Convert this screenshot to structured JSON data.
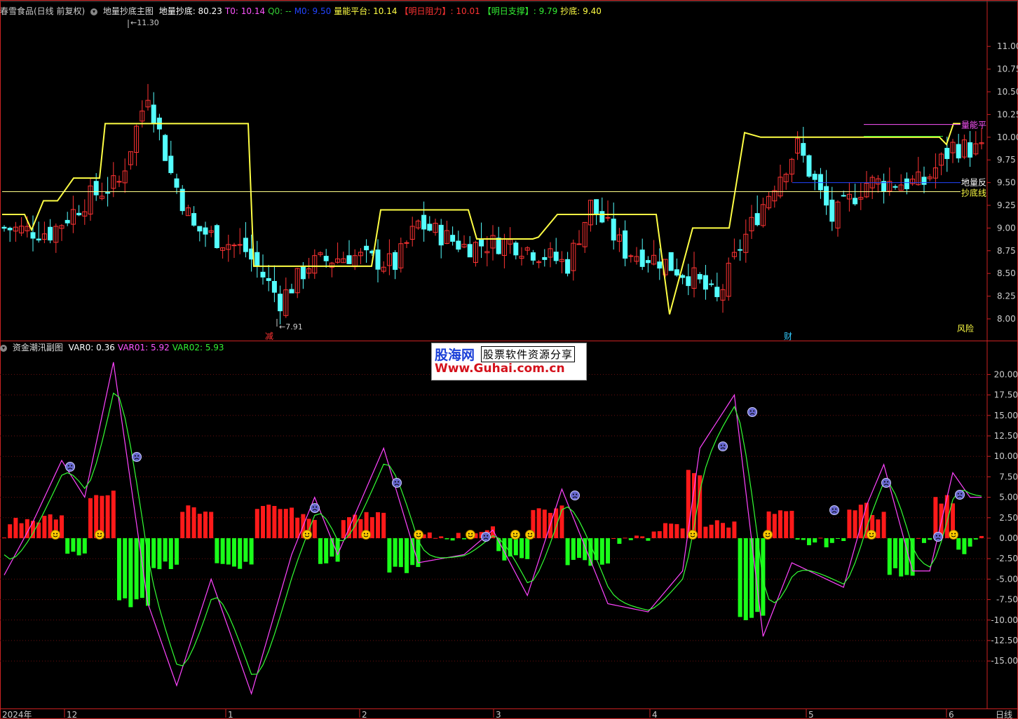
{
  "main_header": {
    "stock": "春雪食品(日线 前复权)",
    "indicator": "地量抄底主图",
    "items": [
      {
        "label": "地量抄底: 80.23",
        "color": "#ffffff"
      },
      {
        "label": "T0: 10.14",
        "color": "#ff55ff"
      },
      {
        "label": "Q0: --",
        "color": "#33cc33"
      },
      {
        "label": "M0: 9.50",
        "color": "#2244ff"
      },
      {
        "label": "量能平台: 10.14",
        "color": "#ffff44"
      },
      {
        "label": "【明日阻力】: 10.01",
        "color": "#ff3333"
      },
      {
        "label": "【明日支撑】: 9.79",
        "color": "#33ee33"
      },
      {
        "label": "抄底: 9.40",
        "color": "#ffff44"
      }
    ]
  },
  "sub_header": {
    "indicator": "资金潮汛副图",
    "items": [
      {
        "label": "VAR0: 0.36",
        "color": "#ffffff"
      },
      {
        "label": "VAR01: 5.92",
        "color": "#ff55ff"
      },
      {
        "label": "VAR02: 5.93",
        "color": "#33ee33"
      }
    ]
  },
  "main_axis_labels": [
    "11.00",
    "10.75",
    "10.50",
    "10.25",
    "10.00",
    "9.75",
    "9.50",
    "9.25",
    "9.00",
    "8.75",
    "8.50",
    "8.25",
    "8.00"
  ],
  "sub_axis_labels": [
    "20.00",
    "17.50",
    "15.00",
    "12.50",
    "10.00",
    "7.50",
    "5.00",
    "2.50",
    "0.00",
    "-2.50",
    "-5.00",
    "-7.50",
    "-10.00",
    "-12.50",
    "-15.00"
  ],
  "price_annotations": {
    "high": "11.30",
    "low": "7.91"
  },
  "right_line_labels": {
    "platform": "量能平",
    "ground": "地量反",
    "bottom": "抄底线"
  },
  "signal_labels": {
    "reduce": "减",
    "wealth": "财",
    "risk": "风险"
  },
  "x_axis": {
    "year": "2024年",
    "months": [
      "12",
      "1",
      "2",
      "3",
      "4",
      "5",
      "6"
    ],
    "period": "日线"
  },
  "watermark": {
    "line1": "股海网",
    "line2": "股票软件资源分享",
    "line3": "Www.Guhai.com.cn"
  },
  "colors": {
    "up": "#ff3333",
    "down": "#54ffff",
    "platform": "#ffff44",
    "hline": "#ffff88",
    "var01": "#ff44ff",
    "var02": "#33ff33",
    "bar_pos": "#ff1a1a",
    "bar_neg": "#1aff1a",
    "axis": "#cc2222",
    "text_axis": "#cccccc"
  },
  "icons": {
    "collapse": "chevron-down-icon",
    "happy": "smiley-happy-icon",
    "sad": "smiley-sad-icon"
  }
}
